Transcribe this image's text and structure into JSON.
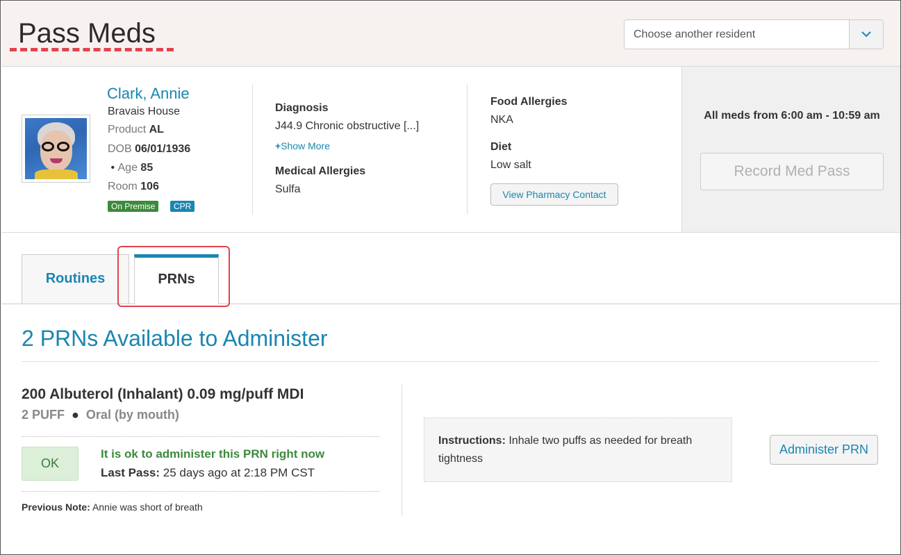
{
  "header": {
    "title": "Pass Meds",
    "resident_select_placeholder": "Choose another resident"
  },
  "resident": {
    "name": "Clark, Annie",
    "location": "Bravais House",
    "product_label": "Product",
    "product_value": "AL",
    "dob_label": "DOB",
    "dob_value": "06/01/1936",
    "age_label": "Age",
    "age_value": "85",
    "room_label": "Room",
    "room_value": "106",
    "badges": [
      "On Premise",
      "CPR"
    ],
    "badge_colors": {
      "on_premise": "#3c8a3c",
      "cpr": "#1a86b0"
    }
  },
  "clinical": {
    "diagnosis_label": "Diagnosis",
    "diagnosis_value": "J44.9 Chronic obstructive [...]",
    "show_more_label": "Show More",
    "medical_allergies_label": "Medical Allergies",
    "medical_allergies_value": "Sulfa",
    "food_allergies_label": "Food Allergies",
    "food_allergies_value": "NKA",
    "diet_label": "Diet",
    "diet_value": "Low salt",
    "pharmacy_button": "View Pharmacy Contact"
  },
  "med_pass": {
    "time_range": "All meds from 6:00 am - 10:59 am",
    "record_button": "Record Med Pass"
  },
  "tabs": [
    {
      "label": "Routines",
      "active": false
    },
    {
      "label": "PRNs",
      "active": true
    }
  ],
  "prn": {
    "section_title": "2 PRNs Available to Administer",
    "med_name": "200 Albuterol (Inhalant) 0.09 mg/puff MDI",
    "dose": "2 PUFF",
    "route": "Oral (by mouth)",
    "status_badge": "OK",
    "status_message": "It is ok to administer this PRN right now",
    "last_pass_label": "Last Pass:",
    "last_pass_value": "25 days ago at 2:18 PM CST",
    "previous_note_label": "Previous Note:",
    "previous_note_value": "Annie was short of breath",
    "instructions_label": "Instructions:",
    "instructions_value": "Inhale two puffs as needed for breath tightness",
    "administer_button": "Administer PRN"
  },
  "colors": {
    "accent": "#1a86b0",
    "success": "#3c8a3c",
    "highlight": "#e0444f"
  }
}
